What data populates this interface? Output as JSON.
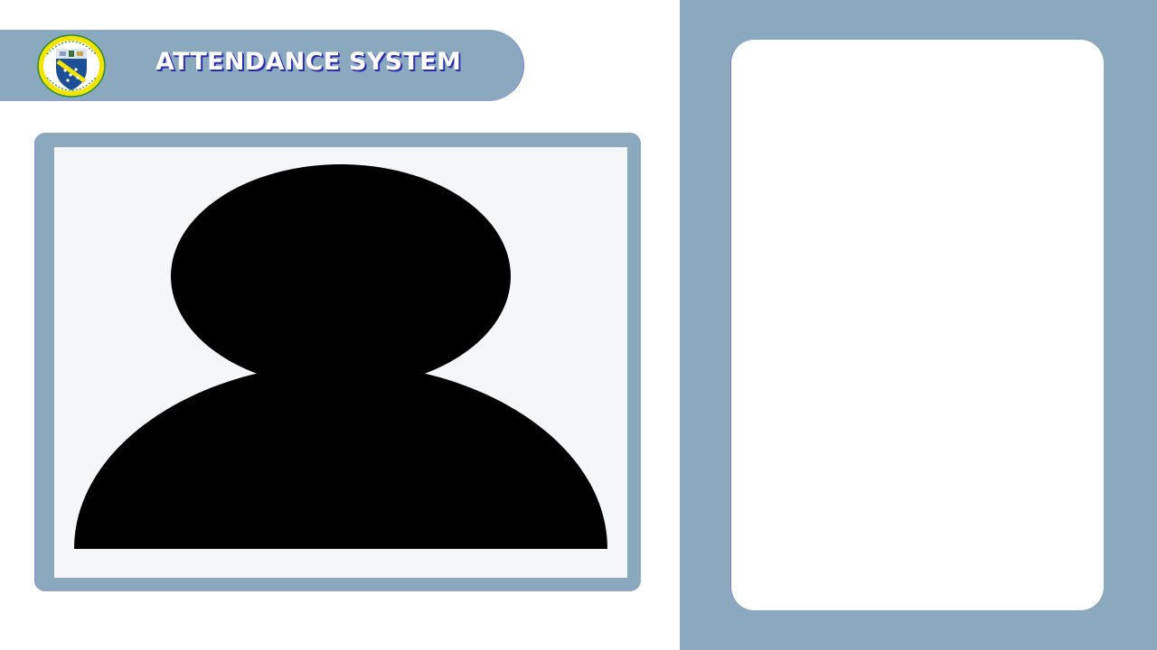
{
  "header": {
    "title": "ATTENDANCE SYSTEM",
    "logo_icon": "institution-crest-icon"
  },
  "camera": {
    "placeholder_icon": "user-silhouette-icon"
  },
  "colors": {
    "panel": "#8ba9be",
    "title_text": "#ffffff",
    "title_shadow": "#2c2bb4",
    "camera_background": "#f5f6f8",
    "silhouette": "#000000"
  }
}
